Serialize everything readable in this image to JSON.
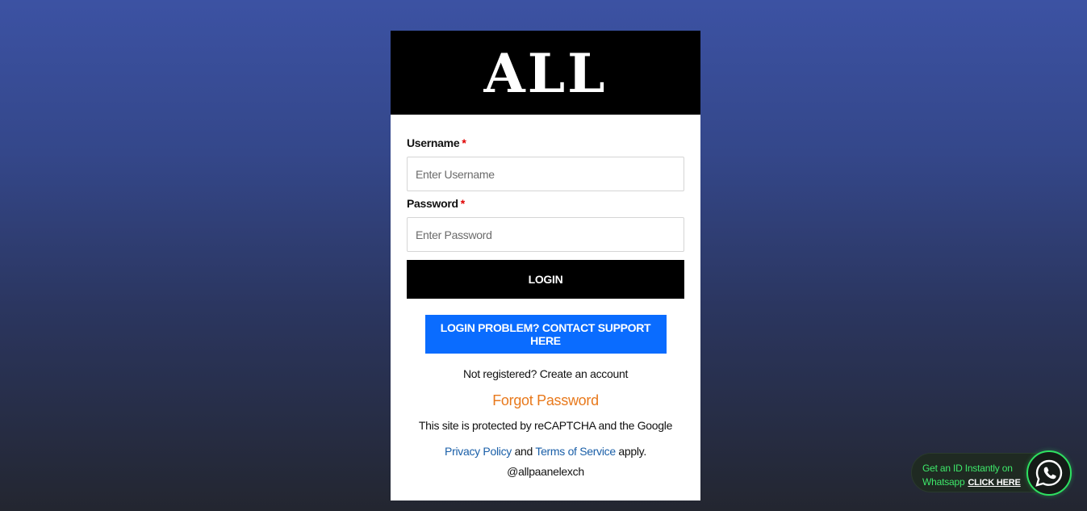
{
  "brand": {
    "logo_text": "ALL"
  },
  "form": {
    "username_label": "Username",
    "username_placeholder": "Enter Username",
    "password_label": "Password",
    "password_placeholder": "Enter Password",
    "required_mark": "*",
    "login_label": "LOGIN",
    "support_label": "LOGIN PROBLEM? CONTACT SUPPORT HERE"
  },
  "links": {
    "register_text": "Not registered? Create an account",
    "forgot_password": "Forgot Password"
  },
  "recaptcha": {
    "prefix": "This site is protected by reCAPTCHA and the Google ",
    "privacy_link": "Privacy Policy",
    "middle": " and ",
    "terms_link": "Terms of Service",
    "suffix": " apply."
  },
  "footer": {
    "handle": "@allpaanelexch"
  },
  "whatsapp": {
    "line1": "Get an ID Instantly on",
    "line2": "Whatsapp",
    "cta": "CLICK HERE",
    "icon": "whatsapp-icon"
  },
  "colors": {
    "login_button": "#000000",
    "support_button": "#0a6cff",
    "forgot_link": "#e8791c",
    "link_blue": "#1a5fa8",
    "required": "#e00000",
    "whatsapp_green": "#2ee061"
  }
}
